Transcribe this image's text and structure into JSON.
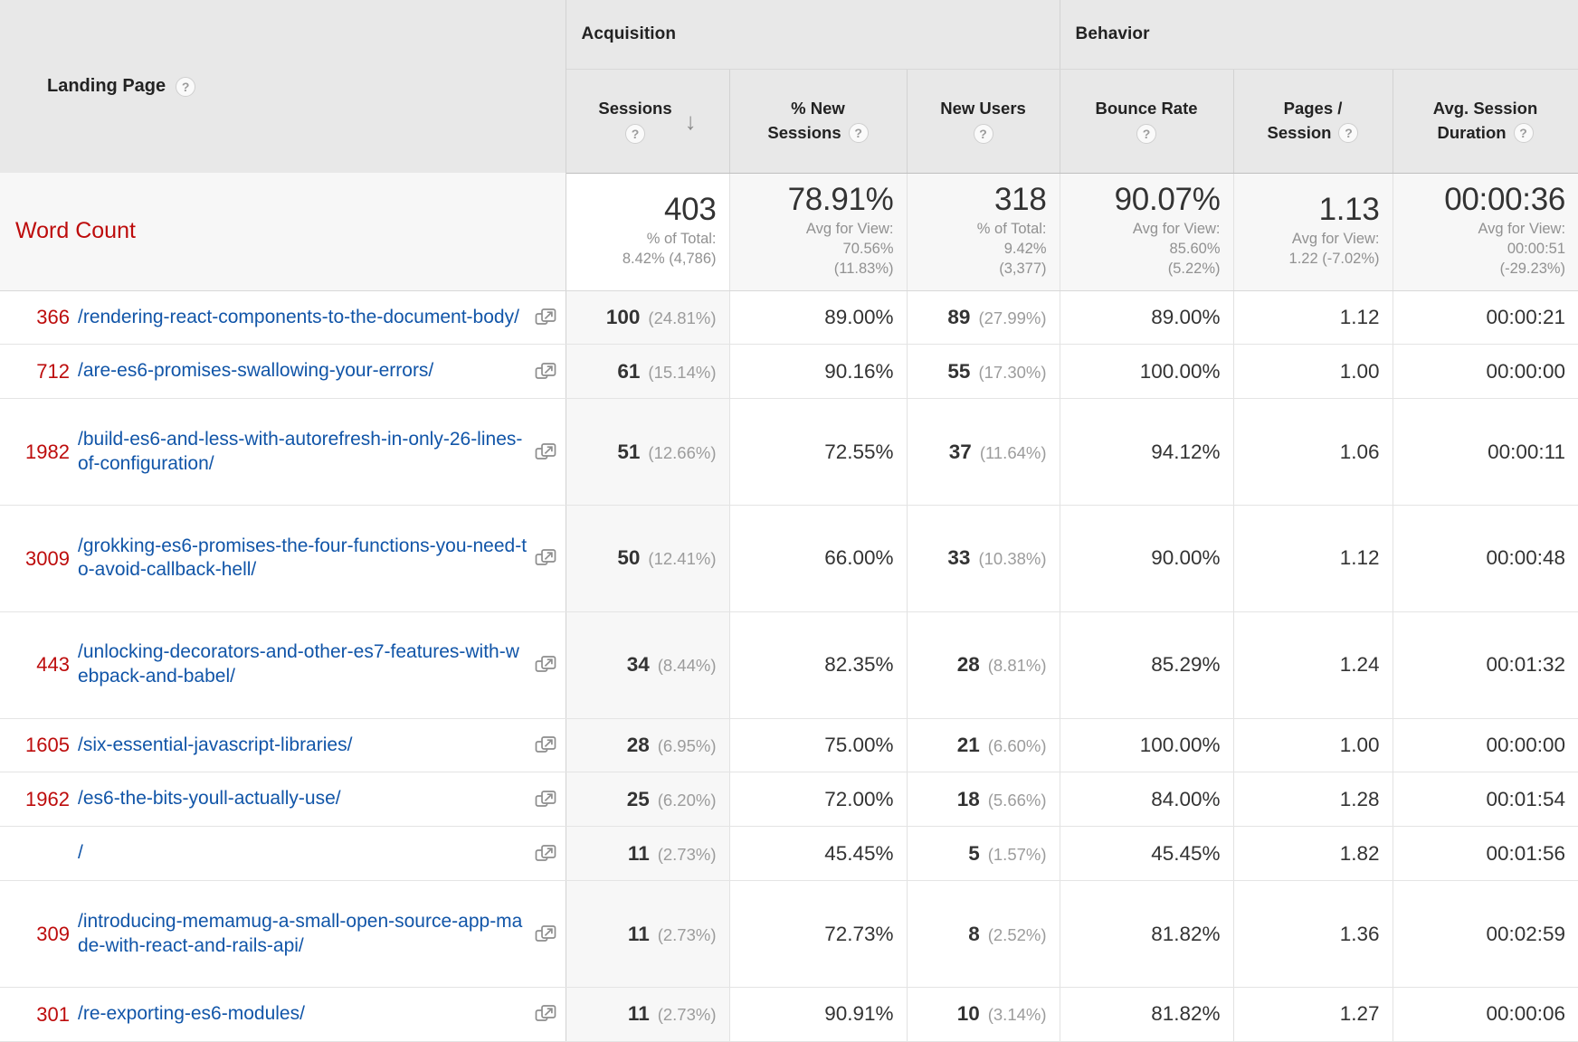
{
  "table": {
    "dimension_header": {
      "label": "Landing Page",
      "help_icon": "question-help-icon"
    },
    "groups": [
      {
        "name": "Acquisition"
      },
      {
        "name": "Behavior"
      }
    ],
    "columns": [
      {
        "key": "sessions",
        "label_line1": "Sessions",
        "label_line2": "",
        "sorted": true,
        "sort_dir": "descending",
        "sort_glyph": "↓"
      },
      {
        "key": "pct_new",
        "label_line1": "% New",
        "label_line2": "Sessions",
        "sorted": false
      },
      {
        "key": "new_users",
        "label_line1": "New Users",
        "label_line2": "",
        "sorted": false
      },
      {
        "key": "bounce",
        "label_line1": "Bounce Rate",
        "label_line2": "",
        "sorted": false
      },
      {
        "key": "pages",
        "label_line1": "Pages /",
        "label_line2": "Session",
        "sorted": false
      },
      {
        "key": "duration",
        "label_line1": "Avg. Session",
        "label_line2": "Duration",
        "sorted": false
      }
    ],
    "summary": {
      "label": "Word Count",
      "cells": [
        {
          "value": "403",
          "sub": [
            "% of Total:",
            "8.42% (4,786)"
          ]
        },
        {
          "value": "78.91%",
          "sub": [
            "Avg for View:",
            "70.56%",
            "(11.83%)"
          ]
        },
        {
          "value": "318",
          "sub": [
            "% of Total:",
            "9.42%",
            "(3,377)"
          ]
        },
        {
          "value": "90.07%",
          "sub": [
            "Avg for View:",
            "85.60%",
            "(5.22%)"
          ]
        },
        {
          "value": "1.13",
          "sub": [
            "Avg for View:",
            "1.22 (-7.02%)"
          ]
        },
        {
          "value": "00:00:36",
          "sub": [
            "Avg for View:",
            "00:00:51",
            "(-29.23%)"
          ]
        }
      ]
    },
    "rows": [
      {
        "word_count": "366",
        "landing_page": "/rendering-react-components-to-the-document-body/",
        "sessions": "100",
        "sessions_pct": "(24.81%)",
        "pct_new": "89.00%",
        "new_users": "89",
        "new_users_pct": "(27.99%)",
        "bounce": "89.00%",
        "pages": "1.12",
        "duration": "00:00:21"
      },
      {
        "word_count": "712",
        "landing_page": "/are-es6-promises-swallowing-your-errors/",
        "sessions": "61",
        "sessions_pct": "(15.14%)",
        "pct_new": "90.16%",
        "new_users": "55",
        "new_users_pct": "(17.30%)",
        "bounce": "100.00%",
        "pages": "1.00",
        "duration": "00:00:00"
      },
      {
        "word_count": "1982",
        "landing_page": "/build-es6-and-less-with-autorefresh-in-only-26-lines-of-configuration/",
        "sessions": "51",
        "sessions_pct": "(12.66%)",
        "pct_new": "72.55%",
        "new_users": "37",
        "new_users_pct": "(11.64%)",
        "bounce": "94.12%",
        "pages": "1.06",
        "duration": "00:00:11"
      },
      {
        "word_count": "3009",
        "landing_page": "/grokking-es6-promises-the-four-functions-you-need-to-avoid-callback-hell/",
        "sessions": "50",
        "sessions_pct": "(12.41%)",
        "pct_new": "66.00%",
        "new_users": "33",
        "new_users_pct": "(10.38%)",
        "bounce": "90.00%",
        "pages": "1.12",
        "duration": "00:00:48"
      },
      {
        "word_count": "443",
        "landing_page": "/unlocking-decorators-and-other-es7-features-with-webpack-and-babel/",
        "sessions": "34",
        "sessions_pct": "(8.44%)",
        "pct_new": "82.35%",
        "new_users": "28",
        "new_users_pct": "(8.81%)",
        "bounce": "85.29%",
        "pages": "1.24",
        "duration": "00:01:32"
      },
      {
        "word_count": "1605",
        "landing_page": "/six-essential-javascript-libraries/",
        "sessions": "28",
        "sessions_pct": "(6.95%)",
        "pct_new": "75.00%",
        "new_users": "21",
        "new_users_pct": "(6.60%)",
        "bounce": "100.00%",
        "pages": "1.00",
        "duration": "00:00:00"
      },
      {
        "word_count": "1962",
        "landing_page": "/es6-the-bits-youll-actually-use/",
        "sessions": "25",
        "sessions_pct": "(6.20%)",
        "pct_new": "72.00%",
        "new_users": "18",
        "new_users_pct": "(5.66%)",
        "bounce": "84.00%",
        "pages": "1.28",
        "duration": "00:01:54"
      },
      {
        "word_count": "",
        "landing_page": "/",
        "sessions": "11",
        "sessions_pct": "(2.73%)",
        "pct_new": "45.45%",
        "new_users": "5",
        "new_users_pct": "(1.57%)",
        "bounce": "45.45%",
        "pages": "1.82",
        "duration": "00:01:56"
      },
      {
        "word_count": "309",
        "landing_page": "/introducing-memamug-a-small-open-source-app-made-with-react-and-rails-api/",
        "sessions": "11",
        "sessions_pct": "(2.73%)",
        "pct_new": "72.73%",
        "new_users": "8",
        "new_users_pct": "(2.52%)",
        "bounce": "81.82%",
        "pages": "1.36",
        "duration": "00:02:59"
      },
      {
        "word_count": "301",
        "landing_page": "/re-exporting-es6-modules/",
        "sessions": "11",
        "sessions_pct": "(2.73%)",
        "pct_new": "90.91%",
        "new_users": "10",
        "new_users_pct": "(3.14%)",
        "bounce": "81.82%",
        "pages": "1.27",
        "duration": "00:00:06"
      }
    ]
  },
  "colors": {
    "link": "#1155a8",
    "dimension_accent": "#bd0c0c",
    "header_bg": "#e8e8e8",
    "summary_bg": "#f7f7f7",
    "sorted_col_bg": "#f7f7f7"
  }
}
